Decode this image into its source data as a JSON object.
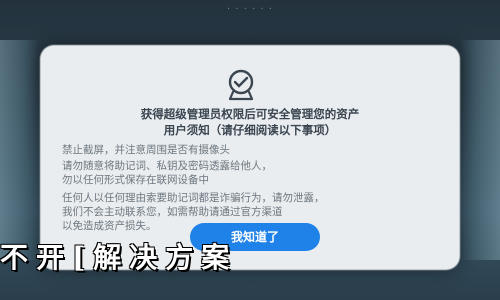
{
  "status_bar": {
    "text": "· · · · · ·"
  },
  "dialog": {
    "title_lines": [
      "获得超级管理员权限后可安全管理您的资产",
      "用户须知（请仔细阅读以下事项）"
    ],
    "body_lines": [
      "禁止截屏，并注意周围是否有摄像头",
      "请勿随意将助记词、私钥及密码透露给他人，",
      "勿以任何形式保存在联网设备中",
      "任何人以任何理由索要助记词都是诈骗行为，请勿泄露，",
      "我们不会主动联系您，如需帮助请通过官方渠道",
      "以免造成资产损失。"
    ],
    "ok_button": "我知道了"
  },
  "headline": {
    "text": "不开[解决方案"
  },
  "colors": {
    "accent": "#1f82e8",
    "dialog_bg": "#e9edef",
    "backdrop": "#2c3f4c"
  }
}
